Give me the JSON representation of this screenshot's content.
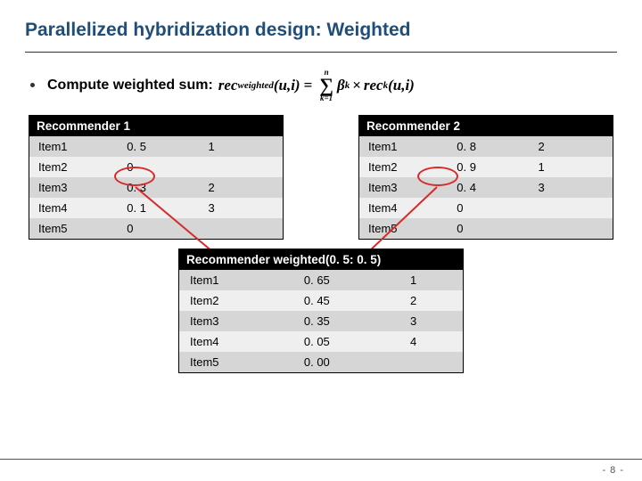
{
  "title": "Parallelized hybridization design: Weighted",
  "bullet_text": "Compute weighted sum:",
  "formula": {
    "lhs_func": "rec",
    "lhs_sub": "weighted",
    "lhs_args": "(u,i)",
    "eq": "=",
    "sum_top": "n",
    "sum_bot": "k=1",
    "rhs_beta": "β",
    "rhs_beta_sub": "k",
    "rhs_times": "×",
    "rhs_func": "rec",
    "rhs_func_sub": "k",
    "rhs_args": "(u,i)"
  },
  "rec1": {
    "header": "Recommender 1",
    "rows": [
      {
        "item": "Item1",
        "score": "0. 5",
        "rank": "1"
      },
      {
        "item": "Item2",
        "score": "0",
        "rank": ""
      },
      {
        "item": "Item3",
        "score": "0. 3",
        "rank": "2"
      },
      {
        "item": "Item4",
        "score": "0. 1",
        "rank": "3"
      },
      {
        "item": "Item5",
        "score": "0",
        "rank": ""
      }
    ]
  },
  "rec2": {
    "header": "Recommender 2",
    "rows": [
      {
        "item": "Item1",
        "score": "0. 8",
        "rank": "2"
      },
      {
        "item": "Item2",
        "score": "0. 9",
        "rank": "1"
      },
      {
        "item": "Item3",
        "score": "0. 4",
        "rank": "3"
      },
      {
        "item": "Item4",
        "score": "0",
        "rank": ""
      },
      {
        "item": "Item5",
        "score": "0",
        "rank": ""
      }
    ]
  },
  "weighted": {
    "header": "Recommender weighted(0. 5: 0. 5)",
    "rows": [
      {
        "item": "Item1",
        "score": "0. 65",
        "rank": "1"
      },
      {
        "item": "Item2",
        "score": "0. 45",
        "rank": "2"
      },
      {
        "item": "Item3",
        "score": "0. 35",
        "rank": "3"
      },
      {
        "item": "Item4",
        "score": "0. 05",
        "rank": "4"
      },
      {
        "item": "Item5",
        "score": "0. 00",
        "rank": ""
      }
    ]
  },
  "page_number": "- 8 -"
}
